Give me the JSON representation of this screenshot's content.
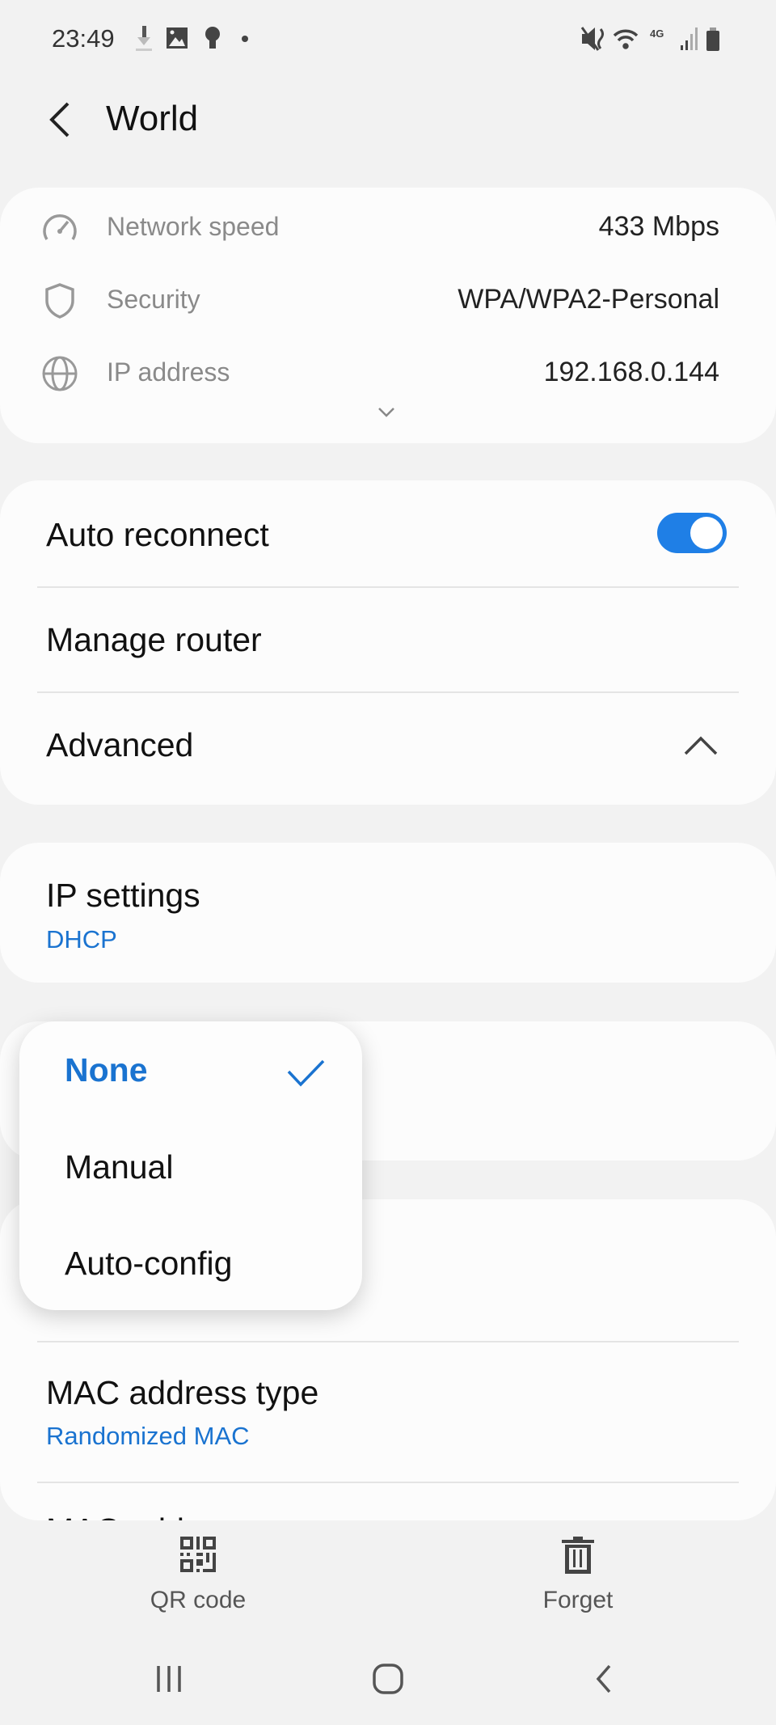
{
  "status_bar": {
    "time": "23:49",
    "left_icons": [
      "download-icon",
      "image-icon",
      "bulb-icon",
      "dot-icon"
    ],
    "right_icons": [
      "mute-icon",
      "wifi-icon",
      "4g-icon",
      "signal-icon",
      "battery-icon"
    ],
    "network_label": "4G"
  },
  "header": {
    "title": "World"
  },
  "info": {
    "rows": [
      {
        "icon": "speed-icon",
        "label": "Network speed",
        "value": "433 Mbps"
      },
      {
        "icon": "shield-icon",
        "label": "Security",
        "value": "WPA/WPA2-Personal"
      },
      {
        "icon": "globe-icon",
        "label": "IP address",
        "value": "192.168.0.144"
      }
    ]
  },
  "settings": {
    "auto_reconnect": "Auto reconnect",
    "auto_reconnect_on": true,
    "manage_router": "Manage router",
    "advanced": "Advanced"
  },
  "ip_settings": {
    "label": "IP settings",
    "value": "DHCP"
  },
  "mac": {
    "label": "MAC address type",
    "value": "Randomized MAC",
    "next_label_partial": "MAC address"
  },
  "dropdown": {
    "options": [
      {
        "label": "None",
        "selected": true
      },
      {
        "label": "Manual",
        "selected": false
      },
      {
        "label": "Auto-config",
        "selected": false
      }
    ]
  },
  "bottom_bar": {
    "qr": "QR code",
    "forget": "Forget"
  },
  "colors": {
    "accent": "#1a73d0",
    "toggle": "#1f7fe6",
    "background": "#f2f2f2",
    "card": "#fcfcfc"
  }
}
